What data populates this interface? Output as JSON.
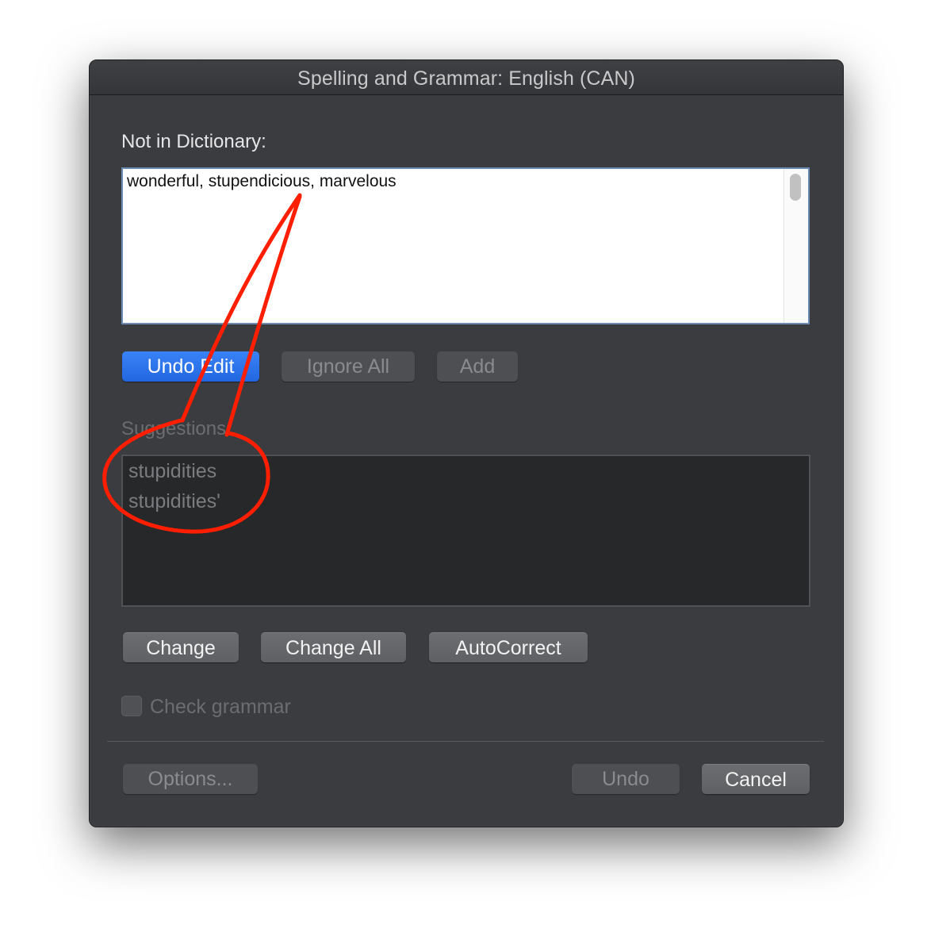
{
  "window": {
    "title": "Spelling and Grammar: English (CAN)"
  },
  "not_in_dictionary": {
    "label": "Not in Dictionary:",
    "text": "wonderful, stupendicious, marvelous"
  },
  "edit_buttons": {
    "undo_edit": "Undo Edit",
    "ignore_all": "Ignore All",
    "add": "Add"
  },
  "suggestions": {
    "label": "Suggestions:",
    "items": [
      "stupidities",
      "stupidities'"
    ]
  },
  "change_buttons": {
    "change": "Change",
    "change_all": "Change All",
    "autocorrect": "AutoCorrect"
  },
  "check_grammar": {
    "label": "Check grammar",
    "checked": false
  },
  "footer": {
    "options": "Options...",
    "undo": "Undo",
    "cancel": "Cancel"
  },
  "colors": {
    "window_bg": "#3b3c3f",
    "primary_button": "#2f76ec",
    "annotation_red": "#ff1e00"
  },
  "annotation": {
    "type": "hand-drawn callout",
    "target": "suggestion-list"
  }
}
